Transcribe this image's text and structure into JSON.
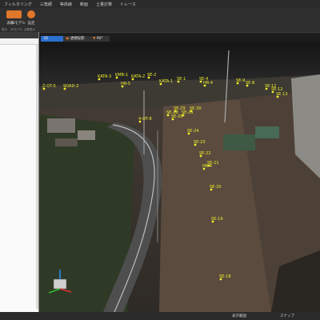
{
  "menu": [
    "フィルタリング",
    "三角網",
    "等高線",
    "断面",
    "土量計算",
    "トレース"
  ],
  "ribbon": {
    "buttons": [
      "表示",
      "3Dモデル",
      "設定"
    ],
    "groups": [
      "表示",
      "3Dモデル",
      "点群表示"
    ]
  },
  "view_tabs": [
    "3D",
    "透視投影",
    "90°"
  ],
  "markers": [
    "Z-OT-5",
    "SOAD-2",
    "KATA-3",
    "KMB-1",
    "KATA-2",
    "SE-2",
    "HR-5",
    "SE-1",
    "KATA-1",
    "SE-4",
    "HR-4",
    "SE-9",
    "SE-8",
    "SE-12",
    "SE-13",
    "SE-11",
    "4-OT-8",
    "SE-28",
    "SE-25",
    "SE-29",
    "SE-30",
    "SE-26",
    "SE-24",
    "SE-23",
    "SE-22",
    "SE-21",
    "HR-4",
    "SE-20",
    "SE-19",
    "SE-18"
  ],
  "status": {
    "right1": "表示範囲",
    "right2": "スナップ"
  }
}
